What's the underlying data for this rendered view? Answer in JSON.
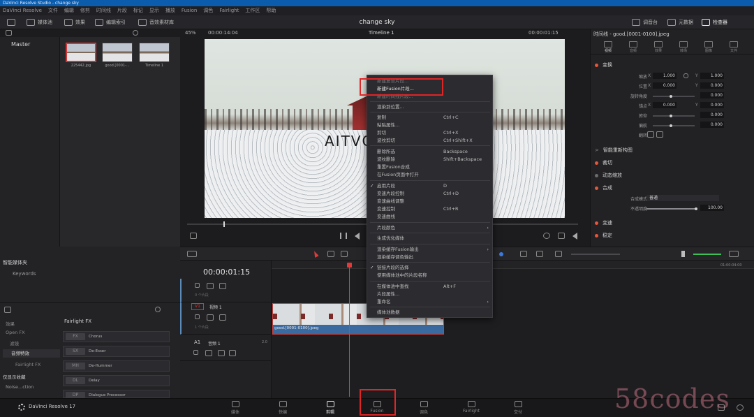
{
  "window": {
    "title": "DaVinci Resolve Studio - change sky"
  },
  "menu": [
    "DaVinci Resolve",
    "文件",
    "编辑",
    "修剪",
    "时间线",
    "片段",
    "标记",
    "显示",
    "播放",
    "Fusion",
    "调色",
    "Fairlight",
    "工作区",
    "帮助"
  ],
  "toolbar": {
    "media_pool": "媒体池",
    "effects": "效果",
    "edit_index": "编辑索引",
    "sound_library": "音效素材库",
    "project_title": "change sky",
    "mixer": "调音台",
    "metadata": "元数据",
    "inspector": "检查器"
  },
  "viewer": {
    "zoom": "45%",
    "source_timecode": "00:00:14:04",
    "timeline_name": "Timeline 1",
    "timecode": "00:00:01:15",
    "watermark_text": "AITVC"
  },
  "bins": {
    "master": "Master",
    "smart_bins": "智能媒体夹",
    "keywords": "Keywords"
  },
  "media": {
    "clips": [
      {
        "name": "225442.jpg"
      },
      {
        "name": "good.[0001-..."
      },
      {
        "name": "Timeline 1"
      }
    ]
  },
  "inspector": {
    "title": "时间线 - good.[0001-0100].jpeg",
    "tabs": [
      "视频",
      "音频",
      "效果",
      "转场",
      "图像",
      "文件"
    ],
    "transform": "变换",
    "zoom_label": "缩放",
    "zoom_x": "1.000",
    "zoom_y": "1.000",
    "position_label": "位置",
    "pos_x": "0.000",
    "pos_y": "0.000",
    "rotation_label": "旋转角度",
    "rotation": "0.000",
    "anchor_label": "锚点",
    "anchor_x": "0.000",
    "anchor_y": "0.000",
    "pitch_label": "俯仰",
    "pitch": "0.000",
    "yaw_label": "偏航",
    "yaw": "0.000",
    "flip_label": "翻转",
    "smart_reframe": "智能重新构图",
    "crop": "裁切",
    "dynamic_zoom": "动态缩放",
    "composite": "合成",
    "composite_mode_label": "合成模式",
    "composite_mode": "普通",
    "opacity_label": "不透明度",
    "opacity": "100.00",
    "speed": "变速",
    "stabilize": "稳定"
  },
  "context_menu": {
    "items": [
      {
        "label": "新建复合片段...",
        "shortcut": "",
        "disabled": true
      },
      {
        "label": "新建Fusion片段...",
        "shortcut": "",
        "disabled": false
      },
      {
        "label": "新建时间线片段...",
        "shortcut": "",
        "disabled": true
      },
      {
        "label": "渲染到位置...",
        "shortcut": "",
        "disabled": false
      },
      {
        "label": "复制",
        "shortcut": "Ctrl+C",
        "disabled": false
      },
      {
        "label": "粘贴属性...",
        "shortcut": "",
        "disabled": false
      },
      {
        "label": "剪切",
        "shortcut": "Ctrl+X",
        "disabled": false
      },
      {
        "label": "波纹剪切",
        "shortcut": "Ctrl+Shift+X",
        "disabled": false
      },
      {
        "label": "删除所选",
        "shortcut": "Backspace",
        "disabled": false
      },
      {
        "label": "波纹删除",
        "shortcut": "Shift+Backspace",
        "disabled": false
      },
      {
        "label": "重置Fusion合成",
        "shortcut": "",
        "disabled": false
      },
      {
        "label": "在Fusion页面中打开",
        "shortcut": "",
        "disabled": false
      },
      {
        "label": "启用片段",
        "shortcut": "D",
        "disabled": false
      },
      {
        "label": "变速片段控制",
        "shortcut": "Ctrl+D",
        "disabled": false
      },
      {
        "label": "变速曲线调整",
        "shortcut": "",
        "disabled": false
      },
      {
        "label": "变速控制",
        "shortcut": "Ctrl+R",
        "disabled": false
      },
      {
        "label": "变速曲线",
        "shortcut": "",
        "disabled": false
      },
      {
        "label": "片段颜色",
        "shortcut": "",
        "disabled": false
      },
      {
        "label": "生成优化媒体",
        "shortcut": "",
        "disabled": false
      },
      {
        "label": "渲染缓存Fusion输出",
        "shortcut": "",
        "disabled": false
      },
      {
        "label": "渲染缓存调色输出",
        "shortcut": "",
        "disabled": false
      },
      {
        "label": "链接片段的选择",
        "shortcut": "",
        "disabled": false
      },
      {
        "label": "使用媒体池中的片段名称",
        "shortcut": "",
        "disabled": false
      },
      {
        "label": "在媒体池中查找",
        "shortcut": "Alt+F",
        "disabled": false
      },
      {
        "label": "片段属性...",
        "shortcut": "",
        "disabled": false
      },
      {
        "label": "重命名",
        "shortcut": "",
        "disabled": false
      },
      {
        "label": "媒体池数据",
        "shortcut": "",
        "disabled": false
      }
    ]
  },
  "effects_panel": {
    "tree": [
      "效果",
      "Open FX",
      "滤镜",
      "音频特效",
      "Fairlight FX"
    ],
    "favorites": "仅显示收藏",
    "favorite_item": "Noise...ction",
    "header": "Fairlight FX",
    "items": [
      {
        "icon": "FX",
        "name": "Chorus"
      },
      {
        "icon": "SX",
        "name": "De-Esser"
      },
      {
        "icon": "MH",
        "name": "De-Hummer"
      },
      {
        "icon": "DL",
        "name": "Delay"
      },
      {
        "icon": "DP",
        "name": "Dialogue Processor"
      }
    ]
  },
  "timeline": {
    "timecode": "00:00:01:15",
    "ruler_end": "01:00:04:00",
    "v1_label": "V1",
    "v1_name": "视频 1",
    "v1_count": "1 个片段",
    "v2_count": "0 个片段",
    "a1_label": "A1",
    "a1_name": "音频 1",
    "a1_ch": "2.0",
    "clip_name": "good.[0001-0100].jpeg"
  },
  "pagebar": {
    "app": "DaVinci Resolve 17",
    "pages": [
      "媒体",
      "快编",
      "剪辑",
      "Fusion",
      "调色",
      "Fairlight",
      "交付"
    ]
  },
  "watermark": "58codes",
  "colors": {
    "accent": "#e23a3a",
    "highlight": "#e02525",
    "clip": "#3b6aa0"
  }
}
